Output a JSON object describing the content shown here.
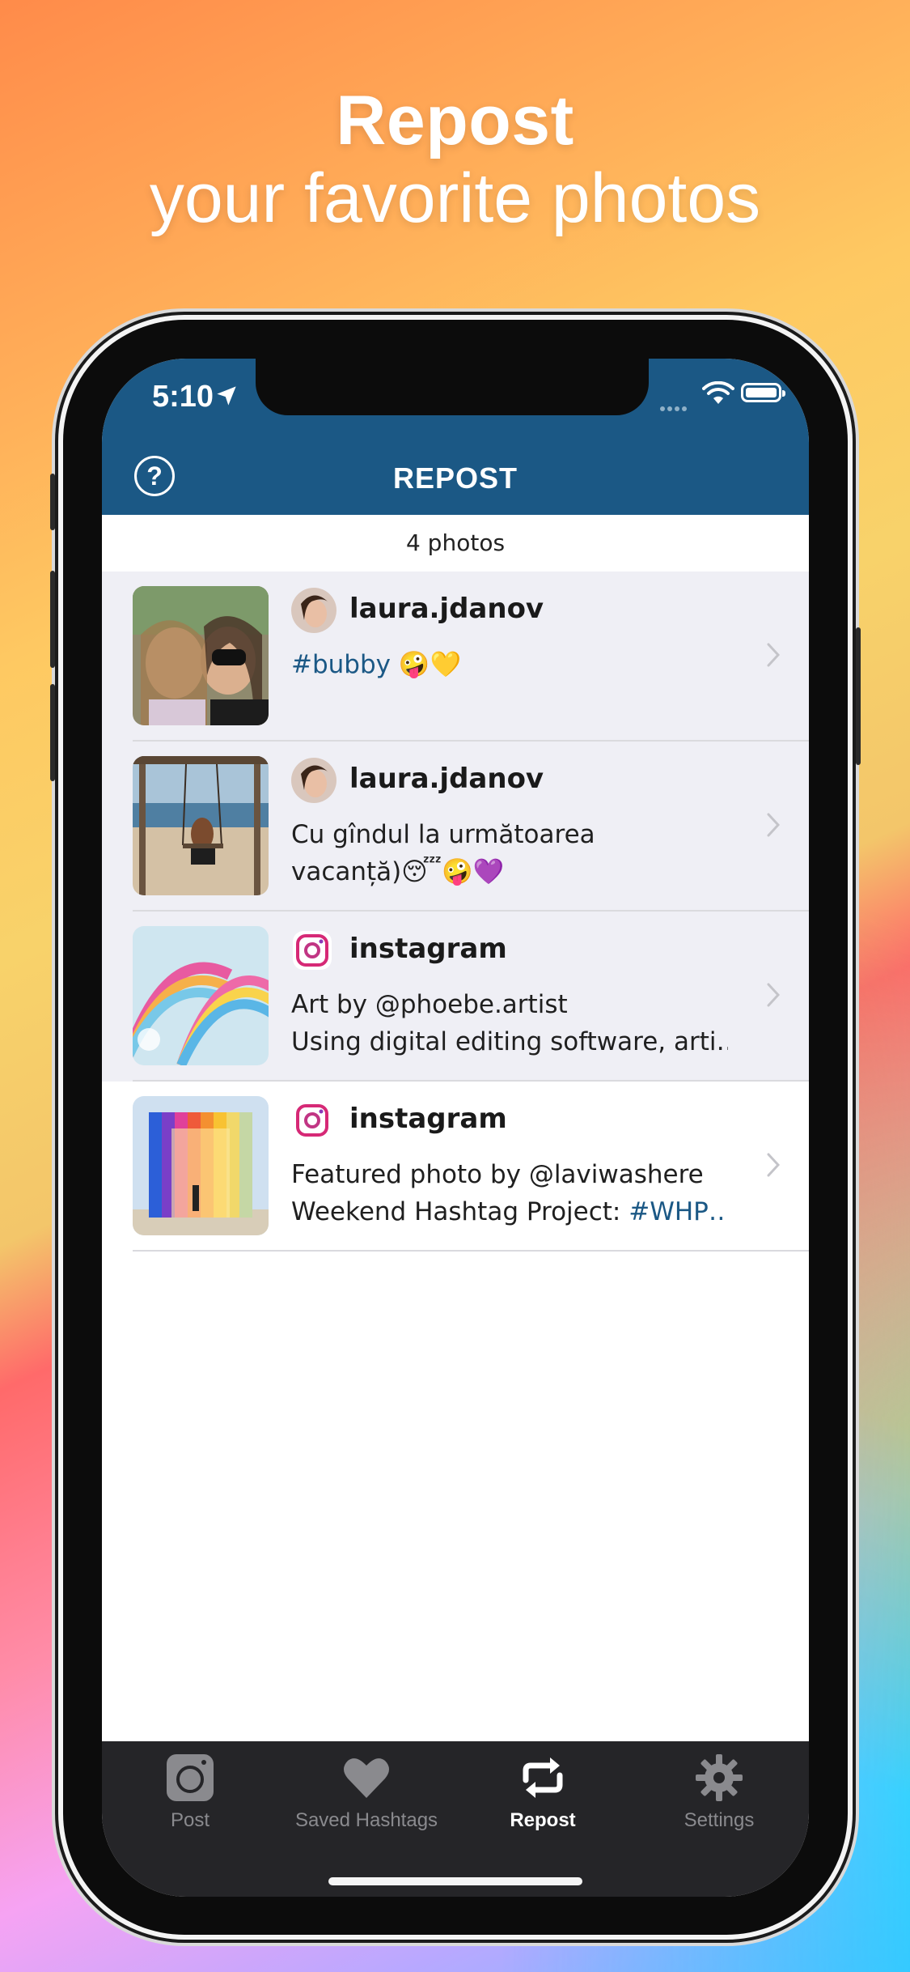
{
  "promo": {
    "line1": "Repost",
    "line2": "your favorite photos"
  },
  "status": {
    "time": "5:10"
  },
  "nav": {
    "title": "REPOST"
  },
  "list_header": {
    "count": "4 photos"
  },
  "posts": [
    {
      "username": "laura.jdanov",
      "caption_tag": "#bubby",
      "caption_text": " 🤪💛",
      "caption_line2": ""
    },
    {
      "username": "laura.jdanov",
      "caption_line1": "Cu gîndul la următoarea",
      "caption_line2": "vacanță)😴🤪💜"
    },
    {
      "username": "instagram",
      "caption_line1": "Art by @phoebe.artist",
      "caption_line2": "Using digital editing software, arti…"
    },
    {
      "username": "instagram",
      "caption_line1": "Featured photo by @laviwashere",
      "caption_line2_prefix": "Weekend Hashtag Project: ",
      "caption_line2_tag": "#WHP…"
    }
  ],
  "tabs": [
    {
      "label": "Post",
      "icon": "camera-icon"
    },
    {
      "label": "Saved Hashtags",
      "icon": "heart-icon"
    },
    {
      "label": "Repost",
      "icon": "repost-icon"
    },
    {
      "label": "Settings",
      "icon": "gear-icon"
    }
  ],
  "colors": {
    "nav": "#1b5885",
    "tag": "#1b5885",
    "tabbar": "#252528",
    "row_gray": "#efeff5"
  }
}
